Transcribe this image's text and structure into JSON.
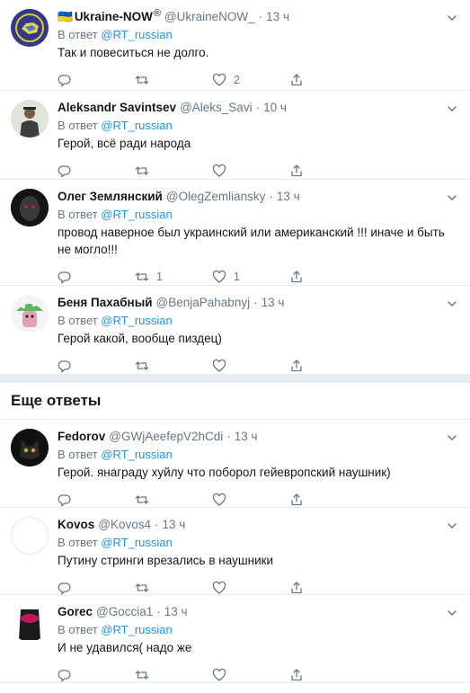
{
  "tweets": [
    {
      "name": "Ukraine-NOW",
      "flag": "🇺🇦",
      "badge": "®",
      "handle": "@UkraineNOW_",
      "time": "13 ч",
      "reply_prefix": "В ответ",
      "reply_to": "@RT_russian",
      "text": "Так и повеситься не долго.",
      "reply_count": "",
      "retweet_count": "",
      "like_count": "2"
    },
    {
      "name": "Aleksandr Savintsev",
      "handle": "@Aleks_Savi",
      "time": "10 ч",
      "reply_prefix": "В ответ",
      "reply_to": "@RT_russian",
      "text": "Герой, всё ради народа",
      "reply_count": "",
      "retweet_count": "",
      "like_count": ""
    },
    {
      "name": "Олег Землянский",
      "handle": "@OlegZemliansky",
      "time": "13 ч",
      "reply_prefix": "В ответ",
      "reply_to": "@RT_russian",
      "text": "провод наверное был украинский или американский !!! иначе и быть не могло!!!",
      "reply_count": "",
      "retweet_count": "1",
      "like_count": "1"
    },
    {
      "name": "Беня Пахабный",
      "handle": "@BenjaPahabnyj",
      "time": "13 ч",
      "reply_prefix": "В ответ",
      "reply_to": "@RT_russian",
      "text": "Герой какой, вообще пиздец)",
      "reply_count": "",
      "retweet_count": "",
      "like_count": ""
    }
  ],
  "more_replies_title": "Еще ответы",
  "more_tweets": [
    {
      "name": "Fedorov",
      "handle": "@GWjAeefepV2hCdi",
      "time": "13 ч",
      "reply_prefix": "В ответ",
      "reply_to": "@RT_russian",
      "text": "Герой. янаграду хуйлу что поборол  гейевропский наушник)",
      "reply_count": "",
      "retweet_count": "",
      "like_count": ""
    },
    {
      "name": "Kovos",
      "handle": "@Kovos4",
      "time": "13 ч",
      "reply_prefix": "В ответ",
      "reply_to": "@RT_russian",
      "text": "Путину стринги врезались в наушники",
      "reply_count": "",
      "retweet_count": "",
      "like_count": ""
    },
    {
      "name": "Gorec",
      "handle": "@Goccia1",
      "time": "13 ч",
      "reply_prefix": "В ответ",
      "reply_to": "@RT_russian",
      "text": "И не удавился( надо же",
      "reply_count": "",
      "retweet_count": "",
      "like_count": ""
    }
  ],
  "colors": {
    "link": "#1b95e0",
    "muted": "#657786",
    "divider": "#e6ecf0"
  },
  "icons": [
    "reply-icon",
    "retweet-icon",
    "like-icon",
    "share-icon",
    "chevron-down-icon"
  ]
}
